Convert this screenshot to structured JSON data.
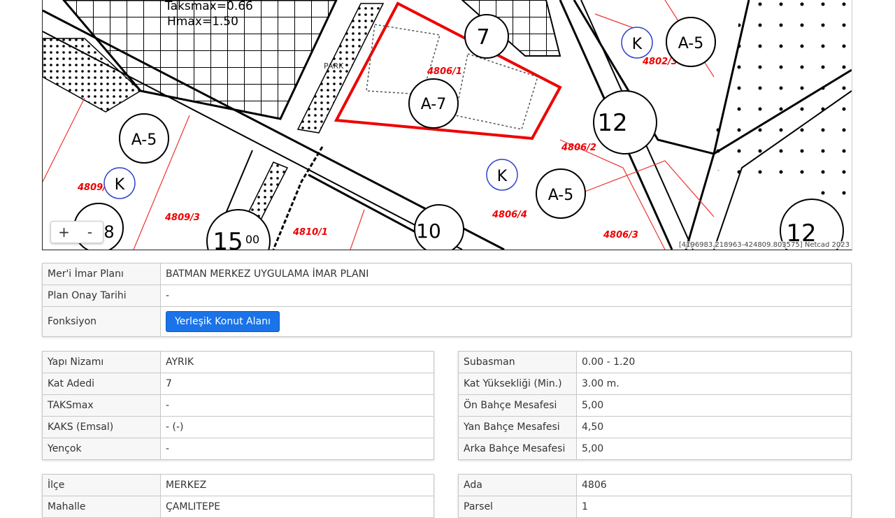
{
  "map": {
    "attribution": "[4196983.218963-424809.803575] Netcad 2023",
    "zoom_in_label": "+",
    "zoom_out_label": "-",
    "labels": {
      "taks": "Taksmax=0.66",
      "hmax": "Hmax=1.50",
      "park": "PARK",
      "parcel_4806_1": "4806/1",
      "parcel_4806_2": "4806/2",
      "parcel_4806_3": "4806/3",
      "parcel_4806_4": "4806/4",
      "parcel_4802_3": "4802/3",
      "parcel_4809_2": "4809/2",
      "parcel_4809_3": "4809/3",
      "parcel_4810_1": "4810/1",
      "zone_a7": "A-7",
      "zone_a5_1": "A-5",
      "zone_a5_2": "A-5",
      "zone_a5_3": "A-5",
      "zone_k_1": "K",
      "zone_k_2": "K",
      "zone_k_3": "K",
      "num_7": "7",
      "num_8": "8",
      "num_12a": "12",
      "num_12b": "12",
      "num_10": "10",
      "num_15": "15",
      "sup_00": "00"
    }
  },
  "plan": {
    "rows": [
      {
        "label": "Mer'i İmar Planı",
        "value": "BATMAN MERKEZ UYGULAMA İMAR PLANI"
      },
      {
        "label": "Plan Onay Tarihi",
        "value": "-"
      }
    ],
    "function_label": "Fonksiyon",
    "function_button": "Yerleşik Konut Alanı"
  },
  "building_left": [
    {
      "label": "Yapı Nizamı",
      "value": "AYRIK"
    },
    {
      "label": "Kat Adedi",
      "value": "7"
    },
    {
      "label": "TAKSmax",
      "value": "-"
    },
    {
      "label": "KAKS (Emsal)",
      "value": "- (-)"
    },
    {
      "label": "Yençok",
      "value": "-"
    }
  ],
  "building_right": [
    {
      "label": "Subasman",
      "value": "0.00 - 1.20"
    },
    {
      "label": "Kat Yüksekliği (Min.)",
      "value": "3.00 m."
    },
    {
      "label": "Ön Bahçe Mesafesi",
      "value": "5,00"
    },
    {
      "label": "Yan Bahçe Mesafesi",
      "value": "4,50"
    },
    {
      "label": "Arka Bahçe Mesafesi",
      "value": "5,00"
    }
  ],
  "location_left": [
    {
      "label": "İlçe",
      "value": "MERKEZ"
    },
    {
      "label": "Mahalle",
      "value": "ÇAMLITEPE"
    }
  ],
  "location_right": [
    {
      "label": "Ada",
      "value": "4806"
    },
    {
      "label": "Parsel",
      "value": "1"
    }
  ]
}
